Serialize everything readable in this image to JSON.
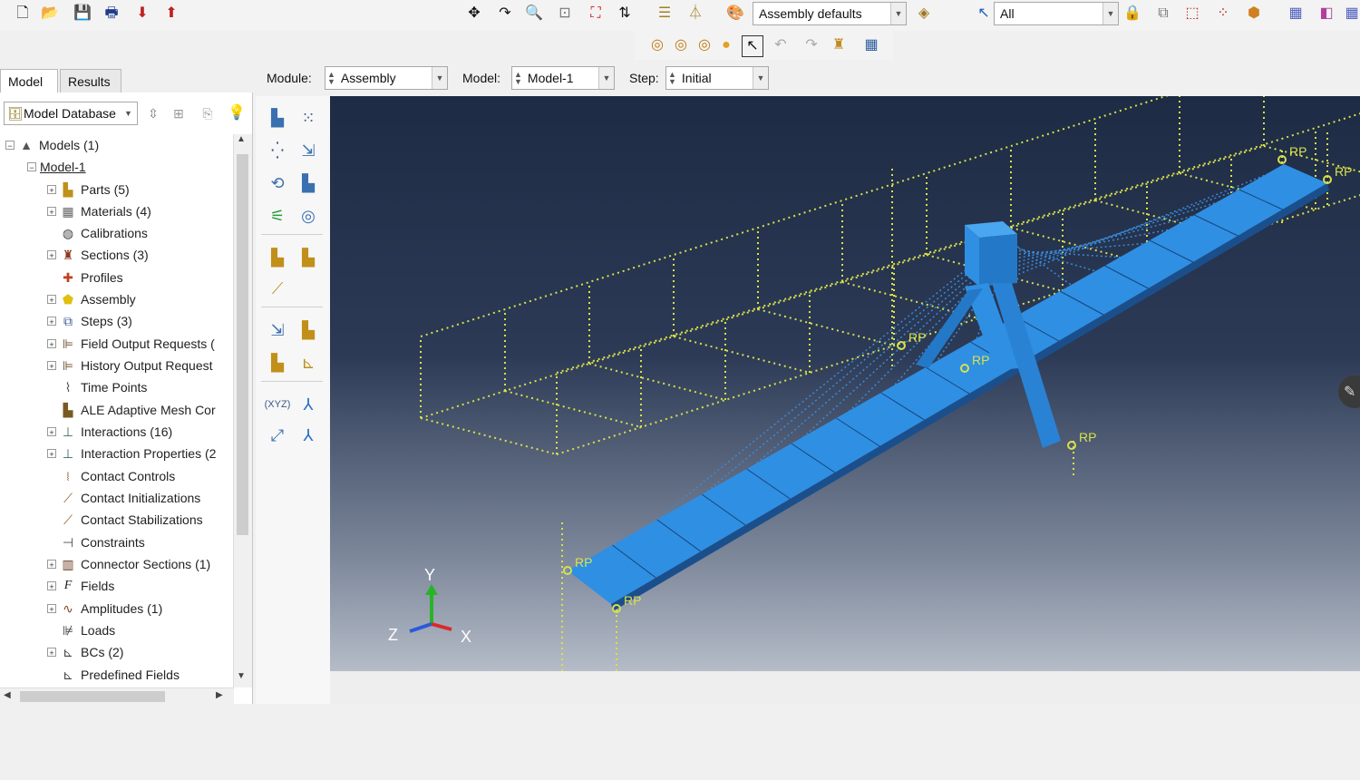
{
  "toolbar": {
    "render_style_value": "Assembly defaults",
    "selection_filter_value": "All"
  },
  "tabs": [
    {
      "label": "Model"
    },
    {
      "label": "Results"
    }
  ],
  "model_tree": {
    "database_selector_value": "Model Database",
    "items": [
      {
        "label": "Models (1)"
      },
      {
        "label": "Model-1"
      },
      {
        "label": "Parts (5)"
      },
      {
        "label": "Materials (4)"
      },
      {
        "label": "Calibrations"
      },
      {
        "label": "Sections (3)"
      },
      {
        "label": "Profiles"
      },
      {
        "label": "Assembly"
      },
      {
        "label": "Steps (3)"
      },
      {
        "label": "Field Output Requests ("
      },
      {
        "label": "History Output Request"
      },
      {
        "label": "Time Points"
      },
      {
        "label": "ALE Adaptive Mesh Cor"
      },
      {
        "label": "Interactions (16)"
      },
      {
        "label": "Interaction Properties (2"
      },
      {
        "label": "Contact Controls"
      },
      {
        "label": "Contact Initializations"
      },
      {
        "label": "Contact Stabilizations"
      },
      {
        "label": "Constraints"
      },
      {
        "label": "Connector Sections (1)"
      },
      {
        "label": "Fields"
      },
      {
        "label": "Amplitudes (1)"
      },
      {
        "label": "Loads"
      },
      {
        "label": "BCs (2)"
      },
      {
        "label": "Predefined Fields"
      }
    ]
  },
  "context_bar": {
    "module_label": "Module:",
    "module_value": "Assembly",
    "model_label": "Model:",
    "model_value": "Model-1",
    "step_label": "Step:",
    "step_value": "Initial"
  },
  "viewport": {
    "rp_label": "RP",
    "triad": {
      "y": "Y",
      "z": "Z",
      "x": "X"
    },
    "colors": {
      "part": "#2f8fe3",
      "wire": "#d9e04a",
      "background_top": "#1d2b44"
    }
  },
  "icons": {
    "toolbar": [
      "new-icon",
      "open-icon",
      "save-icon",
      "print-icon",
      "import-icon",
      "export-icon",
      "pan-icon",
      "rotate-icon",
      "zoom-icon",
      "box-zoom-icon",
      "auto-fit-icon",
      "cycle-views-icon",
      "ruler-icon",
      "measure-icon",
      "render-style-icon",
      "view-cube-icon",
      "select-arrow-icon",
      "lock-icon",
      "query-icon",
      "box-select-icon",
      "points-icon",
      "shaded-icon",
      "iso-view-icon",
      "front-view-icon"
    ],
    "toolbox": [
      "instance-part-icon",
      "linear-pattern-icon",
      "radial-pattern-icon",
      "translate-icon",
      "rotate-instance-icon",
      "merge-icon",
      "constraint-icon",
      "boolean-icon",
      "ref-point-icon",
      "datum-icon",
      "partition-icon",
      "replace-icon",
      "csys-icon",
      "triad-icon",
      "point-icon",
      "axis-icon"
    ]
  }
}
